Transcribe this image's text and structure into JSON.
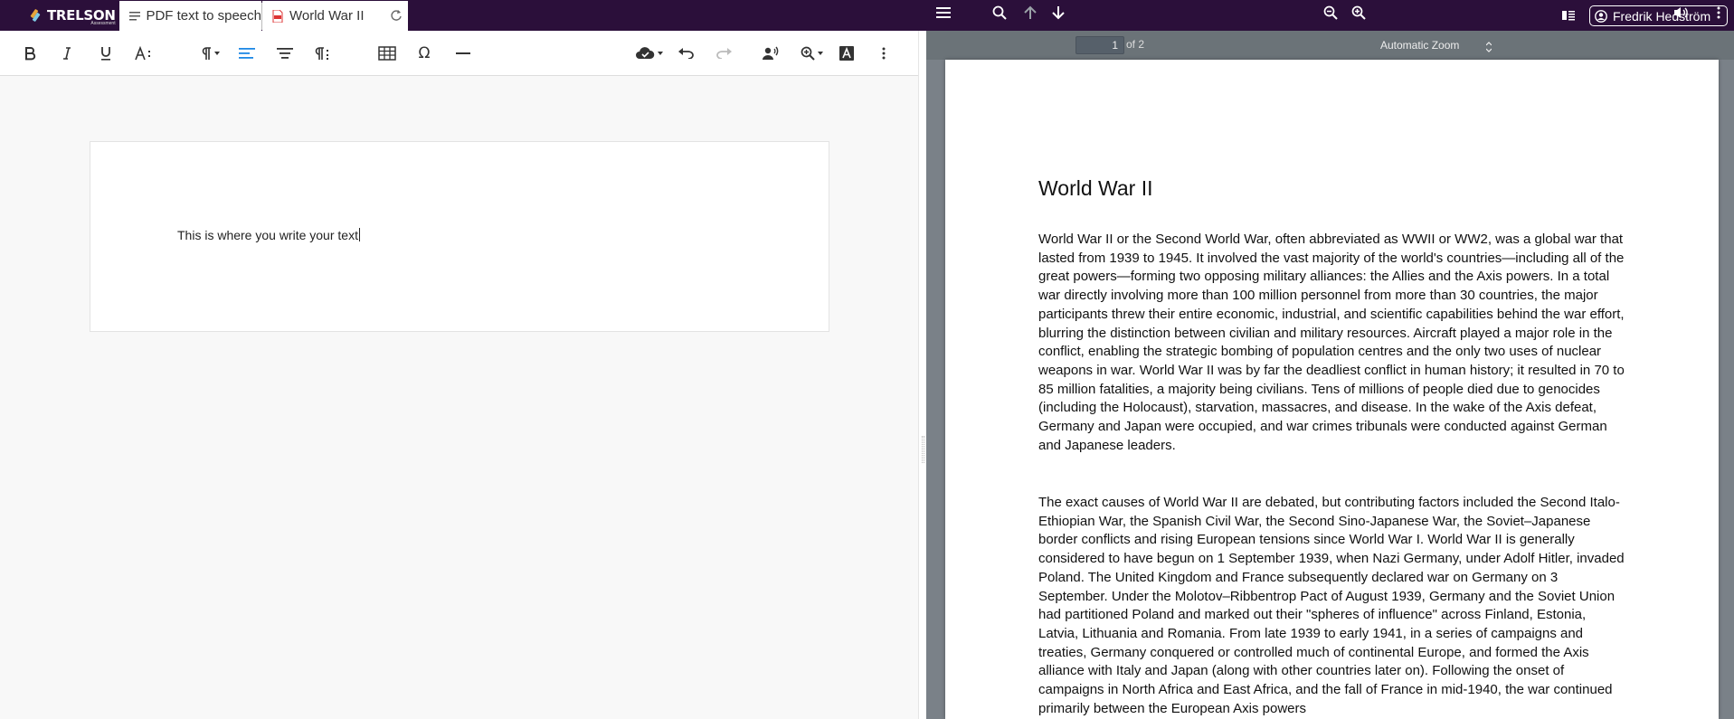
{
  "app": {
    "brand": "TRELSON",
    "brand_sub": "Assessment"
  },
  "tabs": [
    {
      "label": "PDF text to speech",
      "icon": "document-lines-icon"
    },
    {
      "label": "World War II",
      "icon": "pdf-file-icon"
    }
  ],
  "user": {
    "name": "Fredrik Hedström"
  },
  "editor": {
    "toolbar": [
      "bold-icon",
      "italic-icon",
      "underline-icon",
      "text-size-icon",
      "paragraph-format-icon",
      "align-left-icon",
      "align-center-icon",
      "paragraph-marks-icon",
      "table-icon",
      "special-characters-icon",
      "horizontal-line-icon",
      "cloud-save-icon",
      "undo-icon",
      "redo-icon",
      "speaker-icon",
      "zoom-icon",
      "text-highlight-icon",
      "more-vertical-icon"
    ],
    "content": "This is where you write your text"
  },
  "pdf": {
    "page_current": "1",
    "page_of": "of 2",
    "zoom": "Automatic Zoom",
    "title": "World War II",
    "paragraphs": [
      "World War II or the Second World War, often abbreviated as WWII or WW2, was a global war that lasted from 1939 to 1945. It involved the vast majority of the world's countries—including all of the great powers—forming two opposing military alliances: the Allies and the Axis powers. In a total war directly involving more than 100 million personnel from more than 30 countries, the major participants threw their entire economic, industrial, and scientific capabilities behind the war effort, blurring the distinction between civilian and military resources. Aircraft played a major role in the conflict, enabling the strategic bombing of population centres and the only two uses of nuclear weapons in war. World War II was by far the deadliest conflict in human history; it resulted in 70 to 85 million fatalities, a majority being civilians. Tens of millions of people died due to genocides (including the Holocaust), starvation, massacres, and disease. In the wake of the Axis defeat, Germany and Japan were occupied, and war crimes tribunals were conducted against German and Japanese leaders.",
      "The exact causes of World War II are debated, but contributing factors included the Second Italo-Ethiopian War, the Spanish Civil War, the Second Sino-Japanese War, the Soviet–Japanese border conflicts and rising European tensions since World War I. World War II is generally considered to have begun on 1 September 1939, when Nazi Germany, under Adolf Hitler, invaded Poland. The United Kingdom and France subsequently declared war on Germany on 3 September. Under the Molotov–Ribbentrop Pact of August 1939, Germany and the Soviet Union had partitioned Poland and marked out their \"spheres of influence\" across Finland, Estonia, Latvia, Lithuania and Romania. From late 1939 to early 1941, in a series of campaigns and treaties, Germany conquered or controlled much of continental Europe, and formed the Axis alliance with Italy and Japan (along with other countries later on). Following the onset of campaigns in North Africa and East Africa, and the fall of France in mid-1940, the war continued primarily between the European Axis powers"
    ]
  },
  "colors": {
    "topbar": "#2b0f3a",
    "accent": "#1e88e5",
    "pdf_toolbar": "#6b7378"
  }
}
